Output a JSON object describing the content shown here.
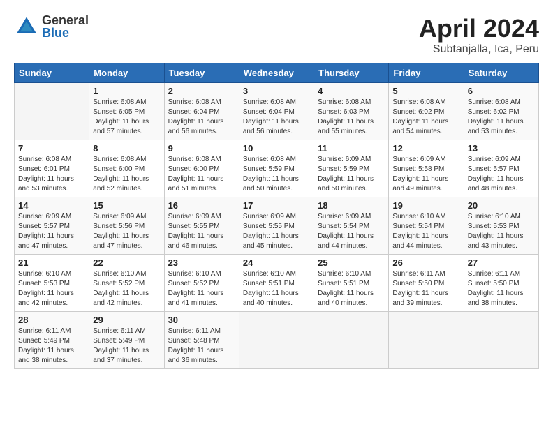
{
  "header": {
    "logo_general": "General",
    "logo_blue": "Blue",
    "title": "April 2024",
    "subtitle": "Subtanjalla, Ica, Peru"
  },
  "days_of_week": [
    "Sunday",
    "Monday",
    "Tuesday",
    "Wednesday",
    "Thursday",
    "Friday",
    "Saturday"
  ],
  "weeks": [
    [
      {
        "day": "",
        "info": ""
      },
      {
        "day": "1",
        "info": "Sunrise: 6:08 AM\nSunset: 6:05 PM\nDaylight: 11 hours\nand 57 minutes."
      },
      {
        "day": "2",
        "info": "Sunrise: 6:08 AM\nSunset: 6:04 PM\nDaylight: 11 hours\nand 56 minutes."
      },
      {
        "day": "3",
        "info": "Sunrise: 6:08 AM\nSunset: 6:04 PM\nDaylight: 11 hours\nand 56 minutes."
      },
      {
        "day": "4",
        "info": "Sunrise: 6:08 AM\nSunset: 6:03 PM\nDaylight: 11 hours\nand 55 minutes."
      },
      {
        "day": "5",
        "info": "Sunrise: 6:08 AM\nSunset: 6:02 PM\nDaylight: 11 hours\nand 54 minutes."
      },
      {
        "day": "6",
        "info": "Sunrise: 6:08 AM\nSunset: 6:02 PM\nDaylight: 11 hours\nand 53 minutes."
      }
    ],
    [
      {
        "day": "7",
        "info": "Sunrise: 6:08 AM\nSunset: 6:01 PM\nDaylight: 11 hours\nand 53 minutes."
      },
      {
        "day": "8",
        "info": "Sunrise: 6:08 AM\nSunset: 6:00 PM\nDaylight: 11 hours\nand 52 minutes."
      },
      {
        "day": "9",
        "info": "Sunrise: 6:08 AM\nSunset: 6:00 PM\nDaylight: 11 hours\nand 51 minutes."
      },
      {
        "day": "10",
        "info": "Sunrise: 6:08 AM\nSunset: 5:59 PM\nDaylight: 11 hours\nand 50 minutes."
      },
      {
        "day": "11",
        "info": "Sunrise: 6:09 AM\nSunset: 5:59 PM\nDaylight: 11 hours\nand 50 minutes."
      },
      {
        "day": "12",
        "info": "Sunrise: 6:09 AM\nSunset: 5:58 PM\nDaylight: 11 hours\nand 49 minutes."
      },
      {
        "day": "13",
        "info": "Sunrise: 6:09 AM\nSunset: 5:57 PM\nDaylight: 11 hours\nand 48 minutes."
      }
    ],
    [
      {
        "day": "14",
        "info": "Sunrise: 6:09 AM\nSunset: 5:57 PM\nDaylight: 11 hours\nand 47 minutes."
      },
      {
        "day": "15",
        "info": "Sunrise: 6:09 AM\nSunset: 5:56 PM\nDaylight: 11 hours\nand 47 minutes."
      },
      {
        "day": "16",
        "info": "Sunrise: 6:09 AM\nSunset: 5:55 PM\nDaylight: 11 hours\nand 46 minutes."
      },
      {
        "day": "17",
        "info": "Sunrise: 6:09 AM\nSunset: 5:55 PM\nDaylight: 11 hours\nand 45 minutes."
      },
      {
        "day": "18",
        "info": "Sunrise: 6:09 AM\nSunset: 5:54 PM\nDaylight: 11 hours\nand 44 minutes."
      },
      {
        "day": "19",
        "info": "Sunrise: 6:10 AM\nSunset: 5:54 PM\nDaylight: 11 hours\nand 44 minutes."
      },
      {
        "day": "20",
        "info": "Sunrise: 6:10 AM\nSunset: 5:53 PM\nDaylight: 11 hours\nand 43 minutes."
      }
    ],
    [
      {
        "day": "21",
        "info": "Sunrise: 6:10 AM\nSunset: 5:53 PM\nDaylight: 11 hours\nand 42 minutes."
      },
      {
        "day": "22",
        "info": "Sunrise: 6:10 AM\nSunset: 5:52 PM\nDaylight: 11 hours\nand 42 minutes."
      },
      {
        "day": "23",
        "info": "Sunrise: 6:10 AM\nSunset: 5:52 PM\nDaylight: 11 hours\nand 41 minutes."
      },
      {
        "day": "24",
        "info": "Sunrise: 6:10 AM\nSunset: 5:51 PM\nDaylight: 11 hours\nand 40 minutes."
      },
      {
        "day": "25",
        "info": "Sunrise: 6:10 AM\nSunset: 5:51 PM\nDaylight: 11 hours\nand 40 minutes."
      },
      {
        "day": "26",
        "info": "Sunrise: 6:11 AM\nSunset: 5:50 PM\nDaylight: 11 hours\nand 39 minutes."
      },
      {
        "day": "27",
        "info": "Sunrise: 6:11 AM\nSunset: 5:50 PM\nDaylight: 11 hours\nand 38 minutes."
      }
    ],
    [
      {
        "day": "28",
        "info": "Sunrise: 6:11 AM\nSunset: 5:49 PM\nDaylight: 11 hours\nand 38 minutes."
      },
      {
        "day": "29",
        "info": "Sunrise: 6:11 AM\nSunset: 5:49 PM\nDaylight: 11 hours\nand 37 minutes."
      },
      {
        "day": "30",
        "info": "Sunrise: 6:11 AM\nSunset: 5:48 PM\nDaylight: 11 hours\nand 36 minutes."
      },
      {
        "day": "",
        "info": ""
      },
      {
        "day": "",
        "info": ""
      },
      {
        "day": "",
        "info": ""
      },
      {
        "day": "",
        "info": ""
      }
    ]
  ]
}
